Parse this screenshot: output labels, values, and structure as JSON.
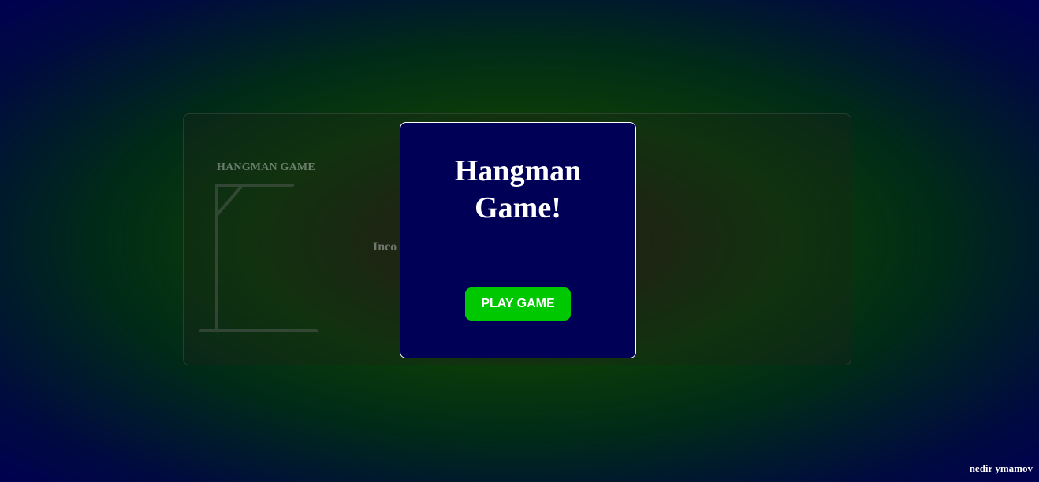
{
  "game_panel": {
    "title": "HANGMAN GAME",
    "incorrect_label": "Inco"
  },
  "modal": {
    "title": "Hangman Game!",
    "play_button_label": "PLAY GAME"
  },
  "footer": {
    "author": "nedir ymamov"
  },
  "colors": {
    "modal_background": "#000057",
    "play_button": "#00c800",
    "gallows": "#555555"
  }
}
